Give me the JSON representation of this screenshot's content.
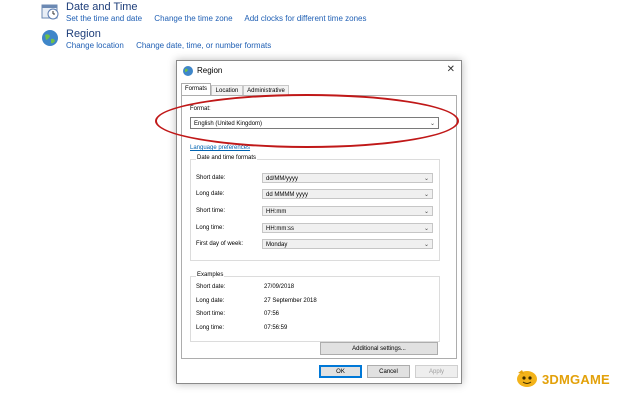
{
  "control_panel": {
    "date_time": {
      "title": "Date and Time",
      "links": [
        "Set the time and date",
        "Change the time zone",
        "Add clocks for different time zones"
      ]
    },
    "region": {
      "title": "Region",
      "links": [
        "Change location",
        "Change date, time, or number formats"
      ]
    }
  },
  "dialog": {
    "title": "Region",
    "close_glyph": "✕",
    "tabs": [
      "Formats",
      "Location",
      "Administrative"
    ],
    "active_tab": "Formats",
    "format": {
      "label": "Format:",
      "value": "English (United Kingdom)"
    },
    "language_preferences_link": "Language preferences",
    "date_time_formats": {
      "group_label": "Date and time formats",
      "rows": [
        {
          "label": "Short date:",
          "value": "dd/MM/yyyy"
        },
        {
          "label": "Long date:",
          "value": "dd MMMM yyyy"
        },
        {
          "label": "Short time:",
          "value": "HH:mm"
        },
        {
          "label": "Long time:",
          "value": "HH:mm:ss"
        },
        {
          "label": "First day of week:",
          "value": "Monday"
        }
      ]
    },
    "examples": {
      "group_label": "Examples",
      "rows": [
        {
          "label": "Short date:",
          "value": "27/09/2018"
        },
        {
          "label": "Long date:",
          "value": "27 September 2018"
        },
        {
          "label": "Short time:",
          "value": "07:56"
        },
        {
          "label": "Long time:",
          "value": "07:56:59"
        }
      ]
    },
    "additional_settings_label": "Additional settings...",
    "buttons": {
      "ok": "OK",
      "cancel": "Cancel",
      "apply": "Apply"
    }
  },
  "annotation": {
    "highlight_color": "#c01818"
  },
  "watermark": {
    "text": "3DMGAME",
    "color": "#e3a10a"
  }
}
